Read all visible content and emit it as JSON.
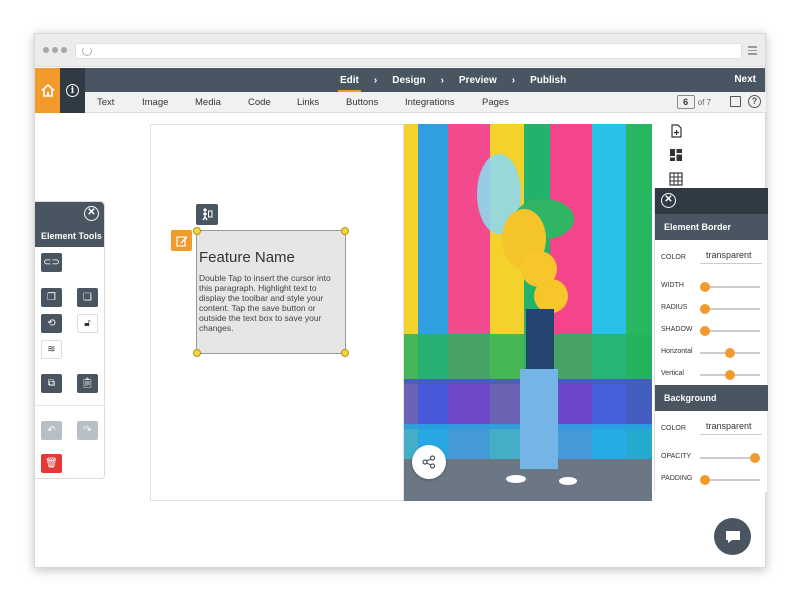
{
  "nav": {
    "steps": [
      "Edit",
      "Design",
      "Preview",
      "Publish"
    ],
    "next_label": "Next",
    "icons": {
      "home": "home-icon",
      "info": "info-icon"
    }
  },
  "menu": {
    "items": [
      "Text",
      "Image",
      "Media",
      "Code",
      "Links",
      "Buttons",
      "Integrations",
      "Pages"
    ],
    "page_current": "6",
    "page_total": "of 7"
  },
  "tools_panel": {
    "title": "Element Tools"
  },
  "text_element": {
    "title": "Feature Name",
    "body": "Double Tap to insert the cursor into this paragraph. Highlight text to display the toolbar and style your content. Tap the save button or outside the text box to save your changes."
  },
  "border_panel": {
    "title": "Element Border",
    "color_label": "COLOR",
    "color_value": "transparent",
    "sliders": [
      {
        "label": "WIDTH",
        "value": 0.0
      },
      {
        "label": "RADIUS",
        "value": 0.0
      },
      {
        "label": "SHADOW",
        "value": 0.0
      },
      {
        "label": "Horizontal",
        "value": 0.5
      },
      {
        "label": "Vertical",
        "value": 0.5
      }
    ]
  },
  "background_panel": {
    "title": "Background",
    "color_label": "COLOR",
    "color_value": "transparent",
    "sliders": [
      {
        "label": "OPACITY",
        "value": 1.0
      },
      {
        "label": "PADDING",
        "value": 0.0
      }
    ]
  },
  "colors": {
    "accent": "#f39a2d",
    "dark": "#495560",
    "darker": "#2f3a44"
  }
}
